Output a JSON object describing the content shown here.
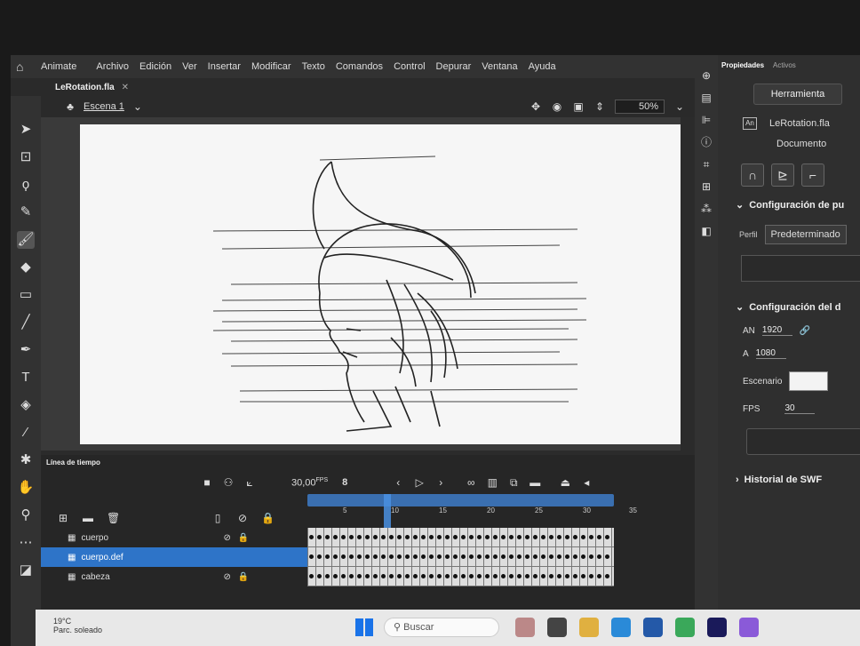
{
  "app": {
    "name": "Animate",
    "menu": [
      "Archivo",
      "Edición",
      "Ver",
      "Insertar",
      "Modificar",
      "Texto",
      "Comandos",
      "Control",
      "Depurar",
      "Ventana",
      "Ayuda"
    ]
  },
  "document": {
    "tab": "LeRotation.fla",
    "scene": "Escena 1",
    "zoom": "50%"
  },
  "properties": {
    "tabs": [
      "Propiedades",
      "Activos"
    ],
    "tool_button": "Herramienta",
    "file_name": "LeRotation.fla",
    "file_badge": "An",
    "doc_label": "Documento",
    "publish_section": "Configuración de pu",
    "profile_label": "Perfil",
    "profile_value": "Predeterminado",
    "doc_section": "Configuración del d",
    "width_label": "AN",
    "width_value": "1920",
    "height_label": "A",
    "height_value": "1080",
    "stage_label": "Escenario",
    "stage_color": "#f3f3f3",
    "fps_label": "FPS",
    "fps_value": "30",
    "swf_history": "Historial de SWF"
  },
  "timeline": {
    "title": "Línea de tiempo",
    "fps": "30,00",
    "fps_unit": "FPS",
    "current_frame": "8",
    "ruler_ticks": [
      "5",
      "10",
      "15",
      "20",
      "25",
      "30",
      "35"
    ],
    "layers": [
      {
        "name": "cuerpo",
        "selected": false
      },
      {
        "name": "cuerpo.def",
        "selected": true
      },
      {
        "name": "cabeza",
        "selected": false
      }
    ]
  },
  "taskbar": {
    "search": "Buscar",
    "weather": "19°C",
    "weather_sub": "Parc. soleado"
  }
}
